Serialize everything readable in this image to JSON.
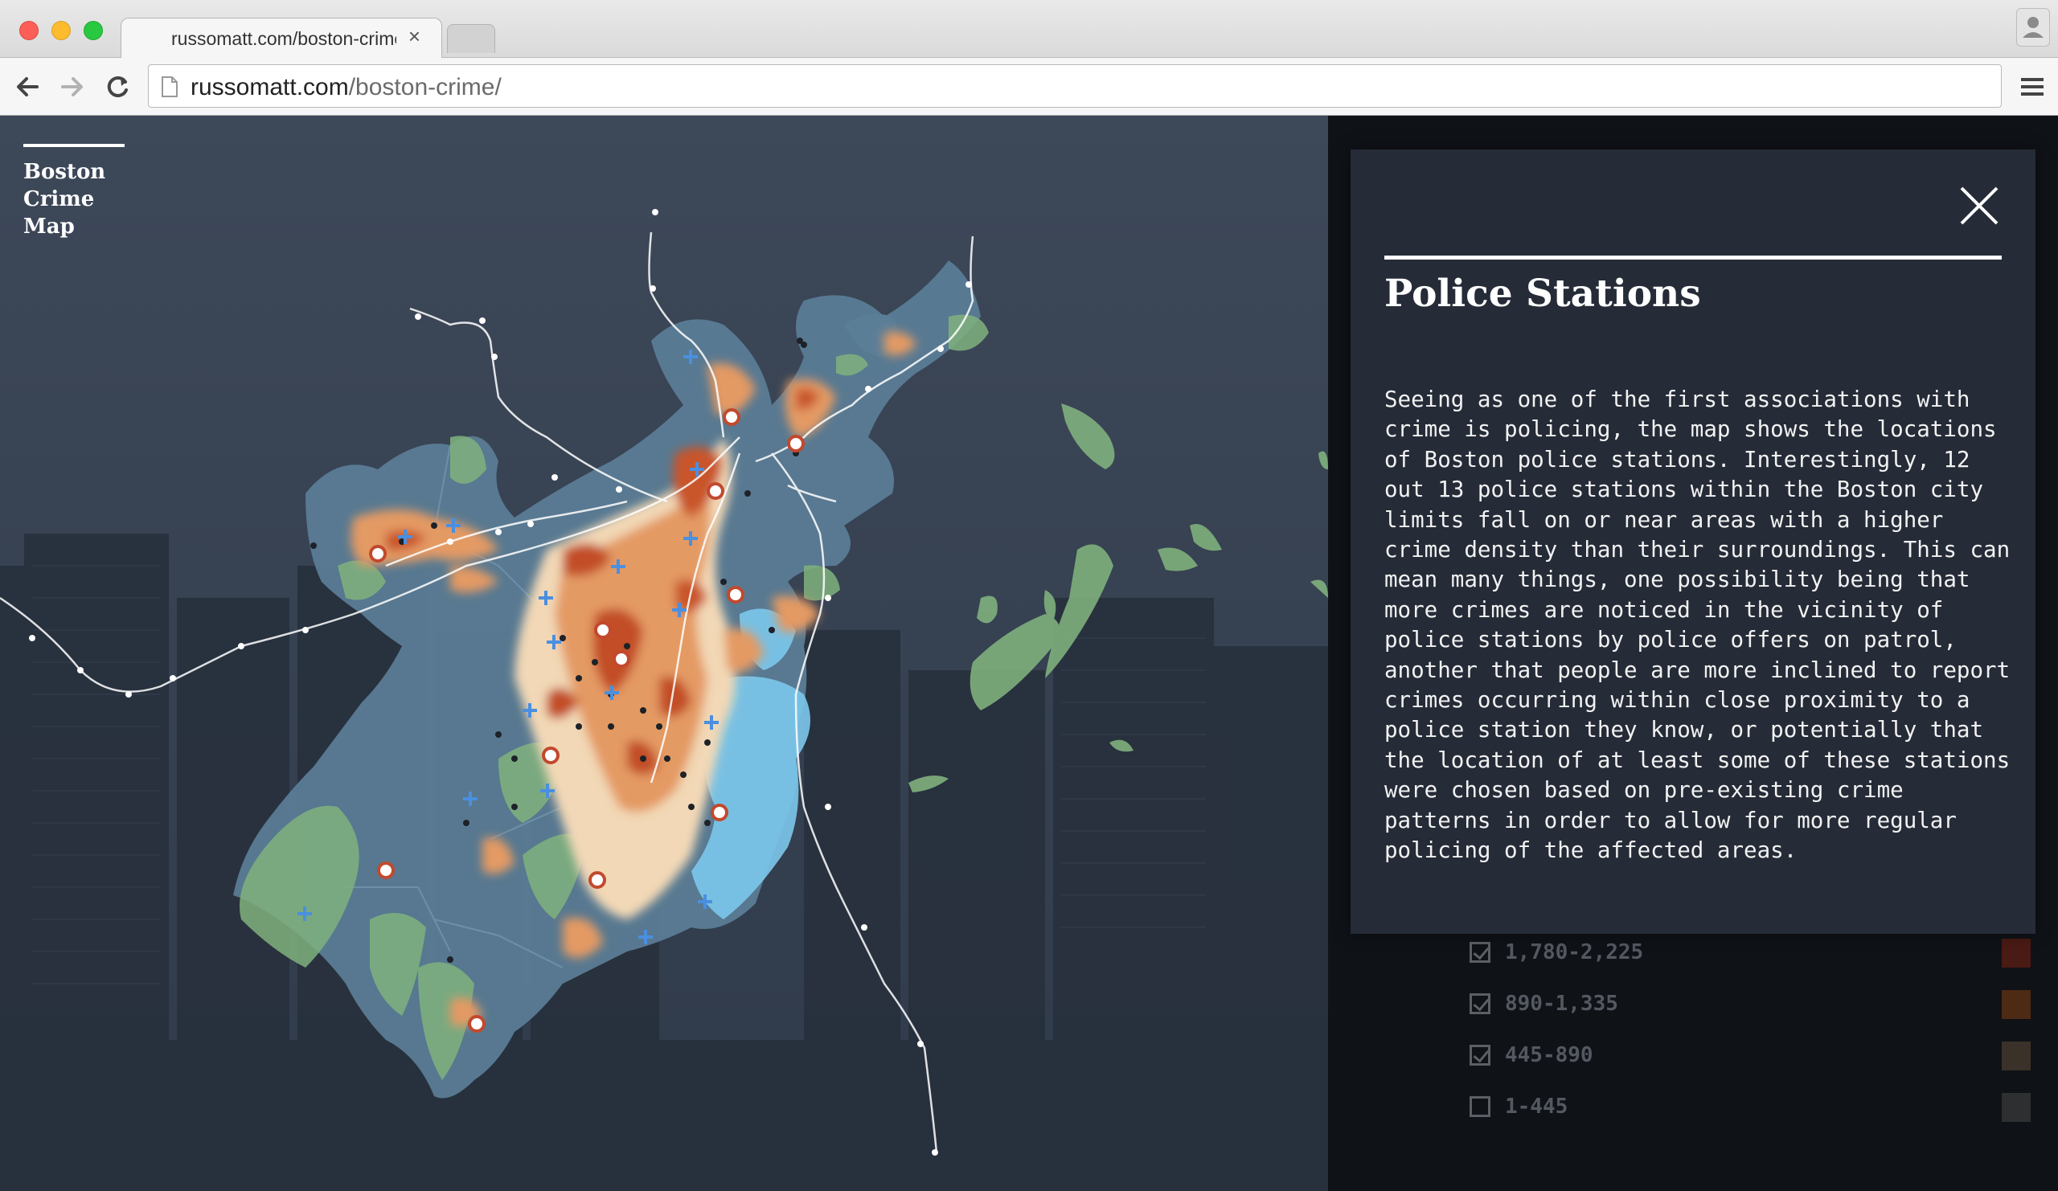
{
  "browser": {
    "tab_title": "russomatt.com/boston-crime/",
    "tab_close": "×",
    "url_host": "russomatt.com",
    "url_path": "/boston-crime/",
    "icons": [
      "back-arrow-icon",
      "forward-arrow-icon",
      "reload-icon",
      "page-icon",
      "menu-icon",
      "profile-icon"
    ]
  },
  "app": {
    "title_lines": [
      "Boston",
      "Crime",
      "Map"
    ]
  },
  "panel": {
    "title": "Police Stations",
    "body": "Seeing as one of the first associations with crime is policing, the map shows the locations of Boston police stations. Interestingly, 12 out 13 police stations within the Boston city limits fall on or near areas with a higher crime density than their surroundings. This can mean many things, one possibility being that more crimes are noticed in the vicinity of police stations by police offers on patrol, another that people are more inclined to report crimes occurring within close proximity to a police station they know, or potentially that the location of at least some of these stations were chosen based on pre-existing crime patterns in order to allow for more regular policing of the affected areas.",
    "close_icon": "close-icon"
  },
  "legend": {
    "items": [
      {
        "label": "1,780-2,225",
        "checked": true,
        "color": "#4a1a14"
      },
      {
        "label": "890-1,335",
        "checked": true,
        "color": "#4d2a14"
      },
      {
        "label": "445-890",
        "checked": true,
        "color": "#3a3128"
      },
      {
        "label": "1-445",
        "checked": false,
        "color": "#2e2f31"
      }
    ]
  },
  "colors": {
    "map_bg": "#3c4758",
    "districts": "#5d8199",
    "parks": "#7fb07d",
    "crime_low": "#f2d9b8",
    "crime_mid": "#e49a63",
    "crime_high": "#c44d25",
    "water_highlight": "#7dc9ee",
    "stations": "#c2492d",
    "transit": "#ffffff"
  }
}
